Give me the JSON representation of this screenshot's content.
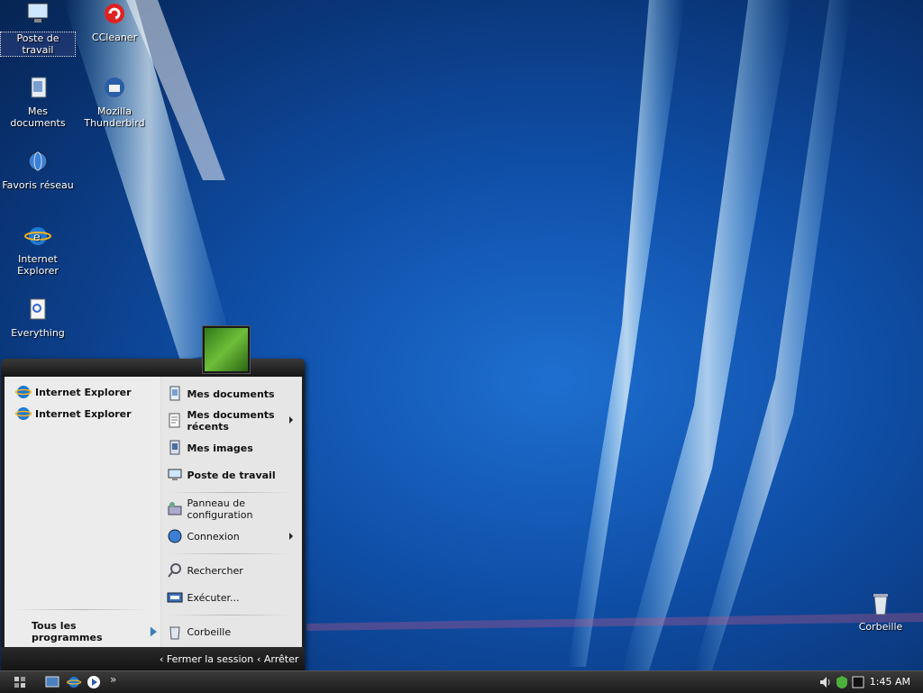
{
  "desktop": {
    "icons": [
      {
        "label": "Poste de travail"
      },
      {
        "label": "CCleaner"
      },
      {
        "label": "Mes documents"
      },
      {
        "label": "Mozilla Thunderbird"
      },
      {
        "label": "Favoris réseau"
      },
      {
        "label": "Internet Explorer"
      },
      {
        "label": "Everything"
      },
      {
        "label": "Corbeille"
      }
    ]
  },
  "start_menu": {
    "pinned": [
      {
        "label": "Internet Explorer"
      },
      {
        "label": "Internet Explorer"
      }
    ],
    "all_programs": "Tous les programmes",
    "right": [
      {
        "label": "Mes documents"
      },
      {
        "label": "Mes documents récents"
      },
      {
        "label": "Mes images"
      },
      {
        "label": "Poste de travail"
      },
      {
        "label": "Panneau de configuration"
      },
      {
        "label": "Connexion"
      },
      {
        "label": "Rechercher"
      },
      {
        "label": "Exécuter..."
      },
      {
        "label": "Corbeille"
      }
    ],
    "logoff": "Fermer la session",
    "shutdown": "Arrêter"
  },
  "taskbar": {
    "clock": "1:45 AM",
    "quick_launch_more": "»"
  }
}
